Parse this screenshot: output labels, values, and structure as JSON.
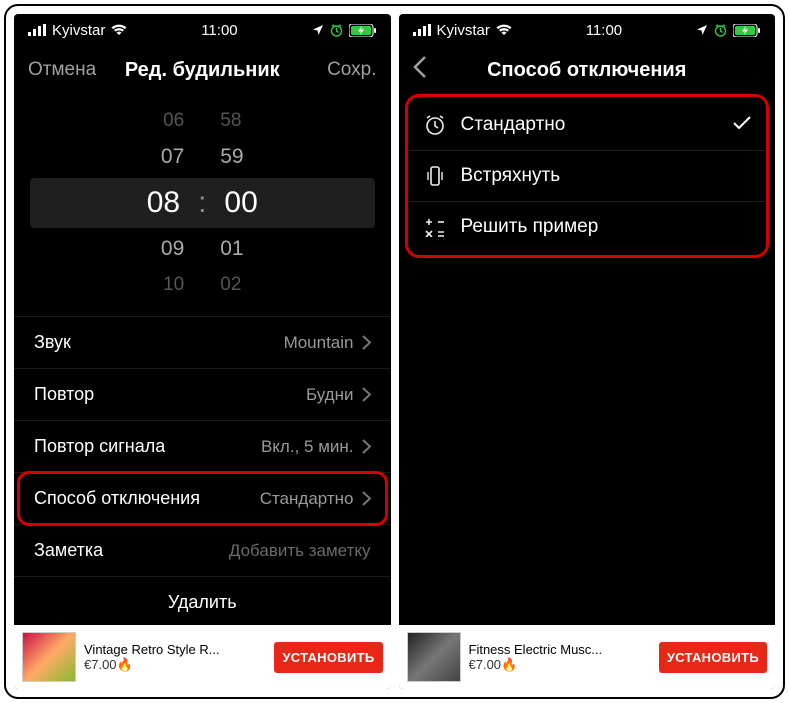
{
  "status": {
    "carrier": "Kyivstar",
    "time": "11:00"
  },
  "left": {
    "nav": {
      "cancel": "Отмена",
      "title": "Ред. будильник",
      "save": "Сохр."
    },
    "picker": {
      "r0h": "06",
      "r0m": "58",
      "r1h": "07",
      "r1m": "59",
      "selh": "08",
      "selm": "00",
      "r3h": "09",
      "r3m": "01",
      "r4h": "10",
      "r4m": "02",
      "colon": ":"
    },
    "rows": {
      "sound_label": "Звук",
      "sound_val": "Mountain",
      "repeat_label": "Повтор",
      "repeat_val": "Будни",
      "snooze_label": "Повтор сигнала",
      "snooze_val": "Вкл., 5 мин.",
      "method_label": "Способ отключения",
      "method_val": "Стандартно",
      "note_label": "Заметка",
      "note_val": "Добавить заметку",
      "delete_label": "Удалить"
    },
    "ad": {
      "title": "Vintage Retro Style R...",
      "price": "€7.00🔥",
      "cta": "УСТАНОВИТЬ"
    }
  },
  "right": {
    "nav": {
      "title": "Способ отключения"
    },
    "methods": {
      "standard": "Стандартно",
      "shake": "Встряхнуть",
      "math": "Решить пример"
    },
    "ad": {
      "title": "Fitness Electric Musc...",
      "price": "€7.00🔥",
      "cta": "УСТАНОВИТЬ"
    }
  }
}
